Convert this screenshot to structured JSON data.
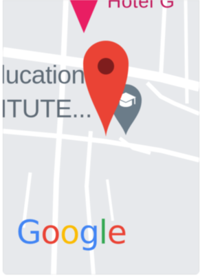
{
  "map": {
    "poi_label_line1": "lucation",
    "poi_label_line2": "ITUTE...",
    "hotel_label": "Hotel G",
    "attribution_letters": [
      "G",
      "o",
      "o",
      "g",
      "l",
      "e"
    ]
  },
  "colors": {
    "map_background": "#e7e9ec",
    "road": "#ffffff",
    "location_pin": "#ea4335",
    "location_pin_center": "#7f1d1d",
    "education_pin": "#6b7c89",
    "hotel_pin": "#e91e63",
    "label_gray": "#5f6b76",
    "google_blue": "#4285f4",
    "google_red": "#ea4335",
    "google_yellow": "#fbbc05",
    "google_green": "#34a853"
  },
  "icons": {
    "location_pin": "red-location-pin-icon",
    "education_pin": "graduation-cap-pin-icon",
    "hotel_pin": "hotel-pin-icon"
  }
}
